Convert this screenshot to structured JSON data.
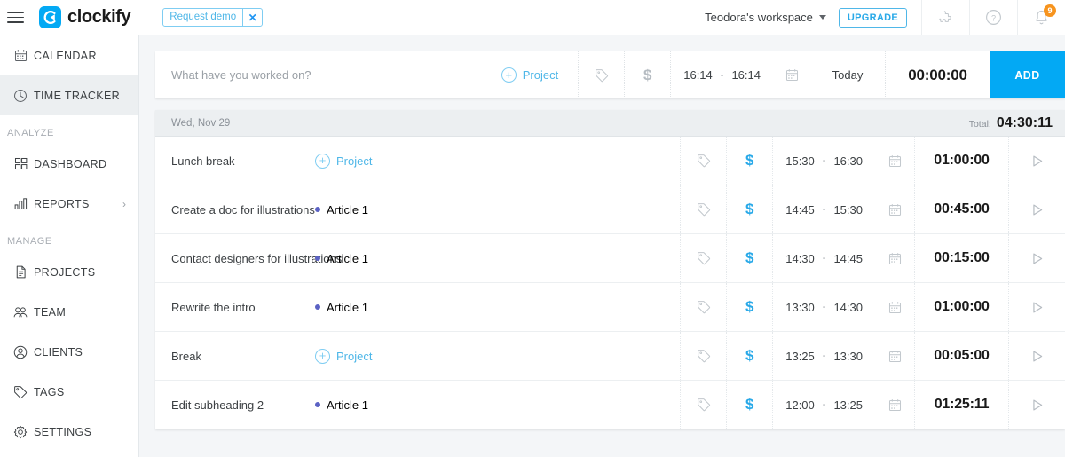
{
  "header": {
    "menu_icon": "hamburger-icon",
    "brand_name": "clockify",
    "demo_chip": {
      "label": "Request demo",
      "close": "✕"
    },
    "workspace": "Teodora's workspace",
    "upgrade_label": "UPGRADE",
    "integrations_icon": "puzzle-icon",
    "help_icon": "question-circle-icon",
    "bell_icon": "bell-icon",
    "notification_count": "9",
    "accent_color": "#03a9f4",
    "badge_color": "#f7941e"
  },
  "sidebar": {
    "items": [
      {
        "label": "CALENDAR",
        "icon": "calendar-icon",
        "active": false
      },
      {
        "label": "TIME TRACKER",
        "icon": "clock-icon",
        "active": true
      }
    ],
    "sections": [
      {
        "title": "ANALYZE",
        "items": [
          {
            "label": "DASHBOARD",
            "icon": "grid-icon",
            "chevron": ""
          },
          {
            "label": "REPORTS",
            "icon": "bar-chart-icon",
            "chevron": "›"
          }
        ]
      },
      {
        "title": "MANAGE",
        "items": [
          {
            "label": "PROJECTS",
            "icon": "document-icon",
            "chevron": ""
          },
          {
            "label": "TEAM",
            "icon": "team-icon",
            "chevron": ""
          },
          {
            "label": "CLIENTS",
            "icon": "user-circle-icon",
            "chevron": ""
          },
          {
            "label": "TAGS",
            "icon": "tag-icon",
            "chevron": ""
          },
          {
            "label": "SETTINGS",
            "icon": "gear-icon",
            "chevron": ""
          }
        ]
      }
    ]
  },
  "timer": {
    "placeholder": "What have you worked on?",
    "value": "",
    "project_label": "Project",
    "tag_icon": "tag-icon",
    "billable_icon": "dollar-icon",
    "billable": false,
    "start_time": "16:14",
    "end_time": "16:14",
    "dash": "-",
    "calendar_icon": "calendar-icon",
    "date_label": "Today",
    "duration": "00:00:00",
    "add_label": "ADD"
  },
  "day": {
    "label": "Wed, Nov 29",
    "total_label": "Total:",
    "total_value": "04:30:11"
  },
  "entries": [
    {
      "title": "Lunch break",
      "project": "",
      "project_placeholder": "Project",
      "project_color": "",
      "has_project": false,
      "billable": true,
      "start": "15:30",
      "end": "16:30",
      "duration": "01:00:00"
    },
    {
      "title": "Create a doc for illustrations",
      "project": "Article 1",
      "project_placeholder": "",
      "project_color": "#5b62c4",
      "has_project": true,
      "billable": true,
      "start": "14:45",
      "end": "15:30",
      "duration": "00:45:00"
    },
    {
      "title": "Contact designers for illustrations",
      "project": "Article 1",
      "project_placeholder": "",
      "project_color": "#5b62c4",
      "has_project": true,
      "billable": true,
      "start": "14:30",
      "end": "14:45",
      "duration": "00:15:00"
    },
    {
      "title": "Rewrite the intro",
      "project": "Article 1",
      "project_placeholder": "",
      "project_color": "#5b62c4",
      "has_project": true,
      "billable": true,
      "start": "13:30",
      "end": "14:30",
      "duration": "01:00:00"
    },
    {
      "title": "Break",
      "project": "",
      "project_placeholder": "Project",
      "project_color": "",
      "has_project": false,
      "billable": true,
      "start": "13:25",
      "end": "13:30",
      "duration": "00:05:00"
    },
    {
      "title": "Edit subheading 2",
      "project": "Article 1",
      "project_placeholder": "",
      "project_color": "#5b62c4",
      "has_project": true,
      "billable": true,
      "start": "12:00",
      "end": "13:25",
      "duration": "01:25:11"
    }
  ],
  "common": {
    "dash": "-",
    "dollar": "$",
    "plus": "+"
  }
}
